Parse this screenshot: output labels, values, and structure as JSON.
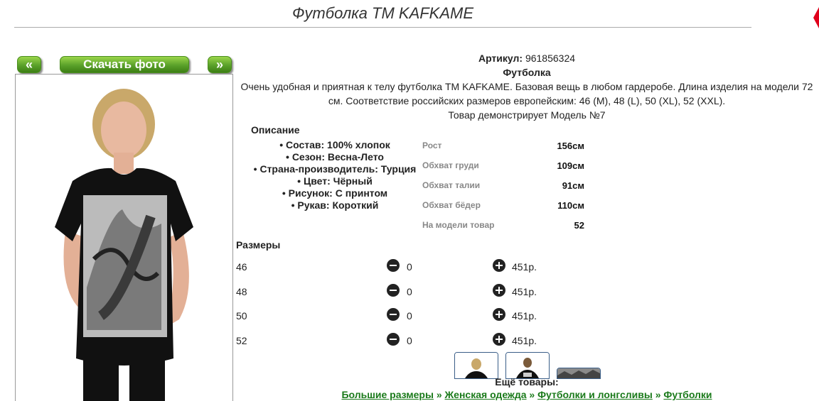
{
  "page": {
    "title": "Футболка TM KAFKAME"
  },
  "photo_nav": {
    "prev": "«",
    "download": "Скачать фото",
    "next": "»"
  },
  "product": {
    "article_label": "Артикул:",
    "article_value": "961856324",
    "type": "Футболка",
    "description": "Очень удобная и приятная к телу футболка TM KAFKAME. Базовая вещь в любом гардеробе. Длина изделия на модели 72 см. Соответствие российских размеров европейским: 46 (M), 48 (L), 50 (XL), 52 (XXL).",
    "model_note": "Товар демонстрирует Модель №7"
  },
  "description_block": {
    "heading": "Описание",
    "items": [
      "• Состав: 100% хлопок",
      "• Сезон: Весна-Лето",
      "• Страна-производитель: Турция",
      "• Цвет: Чёрный",
      "• Рисунок: С принтом",
      "• Рукав: Короткий"
    ]
  },
  "measurements": [
    {
      "label": "Рост",
      "value": "156см"
    },
    {
      "label": "Обхват груди",
      "value": "109см"
    },
    {
      "label": "Обхват талии",
      "value": "91см"
    },
    {
      "label": "Обхват бёдер",
      "value": "110см"
    },
    {
      "label": "На модели товар",
      "value": "52"
    }
  ],
  "sizes": {
    "heading": "Размеры",
    "rows": [
      {
        "size": "46",
        "qty": "0",
        "price": "451р."
      },
      {
        "size": "48",
        "qty": "0",
        "price": "451р."
      },
      {
        "size": "50",
        "qty": "0",
        "price": "451р."
      },
      {
        "size": "52",
        "qty": "0",
        "price": "451р."
      }
    ]
  },
  "more": {
    "heading": "Ещё товары:",
    "breadcrumbs": [
      "Большие размеры",
      "Женская одежда",
      "Футболки и лонгсливы",
      "Футболки"
    ],
    "separator": "»"
  },
  "colors": {
    "button_green": "#5aa12a",
    "link_green": "#1a7a1a",
    "corner_red": "#e0001b"
  }
}
